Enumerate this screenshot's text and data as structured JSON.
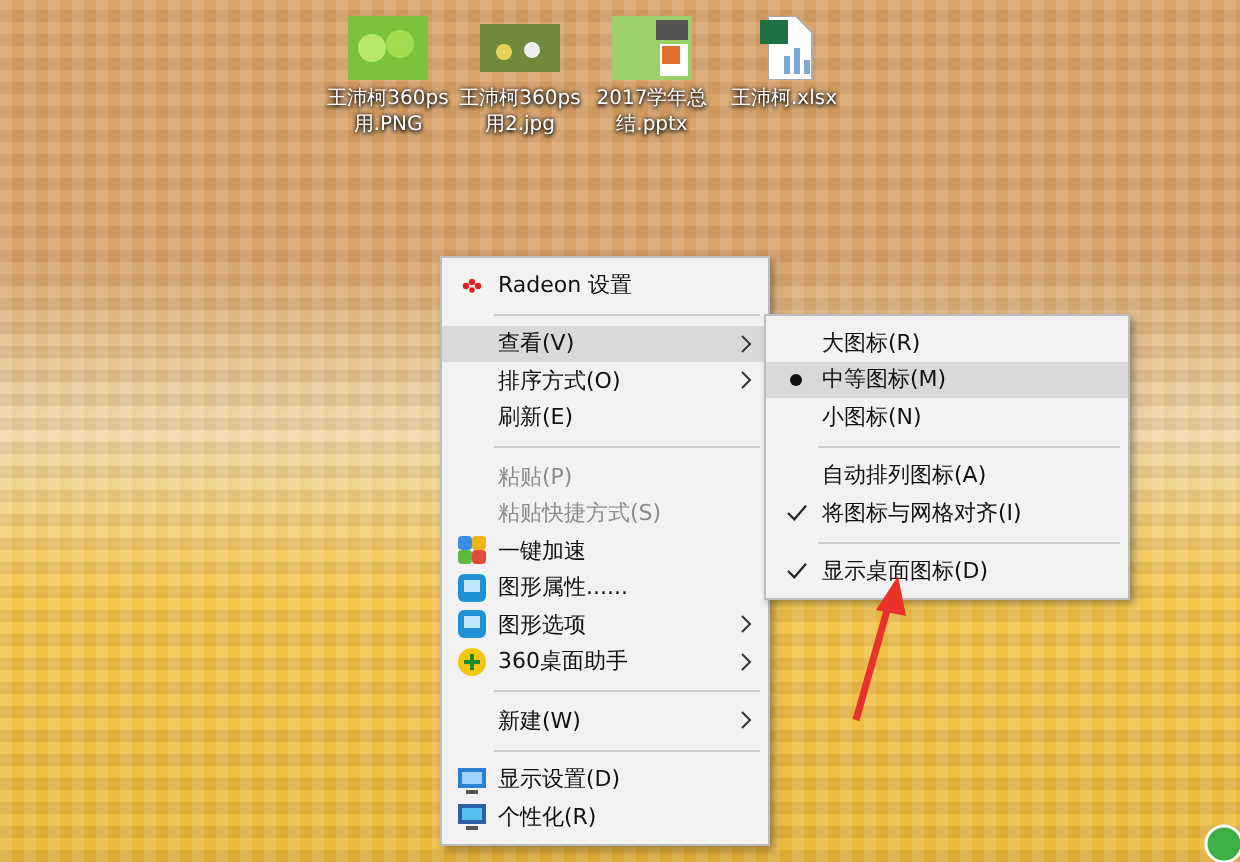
{
  "desktop_icons": [
    {
      "label": "王沛柯360ps用.PNG",
      "kind": "image"
    },
    {
      "label": "王沛柯360ps用2.jpg",
      "kind": "photo"
    },
    {
      "label": "2017学年总结.pptx",
      "kind": "presentation"
    },
    {
      "label": "王沛柯.xlsx",
      "kind": "spreadsheet"
    }
  ],
  "context_menu": {
    "items": [
      {
        "kind": "item",
        "label": "Radeon 设置",
        "highlighted": false,
        "disabled": false,
        "submenu": false
      },
      {
        "kind": "separator"
      },
      {
        "kind": "item",
        "label": "查看(V)",
        "highlighted": true,
        "disabled": false,
        "submenu": true
      },
      {
        "kind": "item",
        "label": "排序方式(O)",
        "highlighted": false,
        "disabled": false,
        "submenu": true
      },
      {
        "kind": "item",
        "label": "刷新(E)",
        "highlighted": false,
        "disabled": false,
        "submenu": false
      },
      {
        "kind": "separator"
      },
      {
        "kind": "item",
        "label": "粘贴(P)",
        "highlighted": false,
        "disabled": true,
        "submenu": false
      },
      {
        "kind": "item",
        "label": "粘贴快捷方式(S)",
        "highlighted": false,
        "disabled": true,
        "submenu": false
      },
      {
        "kind": "item",
        "label": "一键加速",
        "highlighted": false,
        "disabled": false,
        "submenu": false
      },
      {
        "kind": "item",
        "label": "图形属性......",
        "highlighted": false,
        "disabled": false,
        "submenu": false
      },
      {
        "kind": "item",
        "label": "图形选项",
        "highlighted": false,
        "disabled": false,
        "submenu": true
      },
      {
        "kind": "item",
        "label": "360桌面助手",
        "highlighted": false,
        "disabled": false,
        "submenu": true
      },
      {
        "kind": "separator"
      },
      {
        "kind": "item",
        "label": "新建(W)",
        "highlighted": false,
        "disabled": false,
        "submenu": true
      },
      {
        "kind": "separator"
      },
      {
        "kind": "item",
        "label": "显示设置(D)",
        "highlighted": false,
        "disabled": false,
        "submenu": false
      },
      {
        "kind": "item",
        "label": "个性化(R)",
        "highlighted": false,
        "disabled": false,
        "submenu": false
      }
    ]
  },
  "view_submenu": {
    "items": [
      {
        "kind": "radio",
        "label": "大图标(R)",
        "highlighted": false,
        "selected": false
      },
      {
        "kind": "radio",
        "label": "中等图标(M)",
        "highlighted": true,
        "selected": true
      },
      {
        "kind": "radio",
        "label": "小图标(N)",
        "highlighted": false,
        "selected": false
      },
      {
        "kind": "separator"
      },
      {
        "kind": "check",
        "label": "自动排列图标(A)",
        "highlighted": false,
        "checked": false
      },
      {
        "kind": "check",
        "label": "将图标与网格对齐(I)",
        "highlighted": false,
        "checked": true
      },
      {
        "kind": "separator"
      },
      {
        "kind": "check",
        "label": "显示桌面图标(D)",
        "highlighted": false,
        "checked": true
      }
    ]
  }
}
